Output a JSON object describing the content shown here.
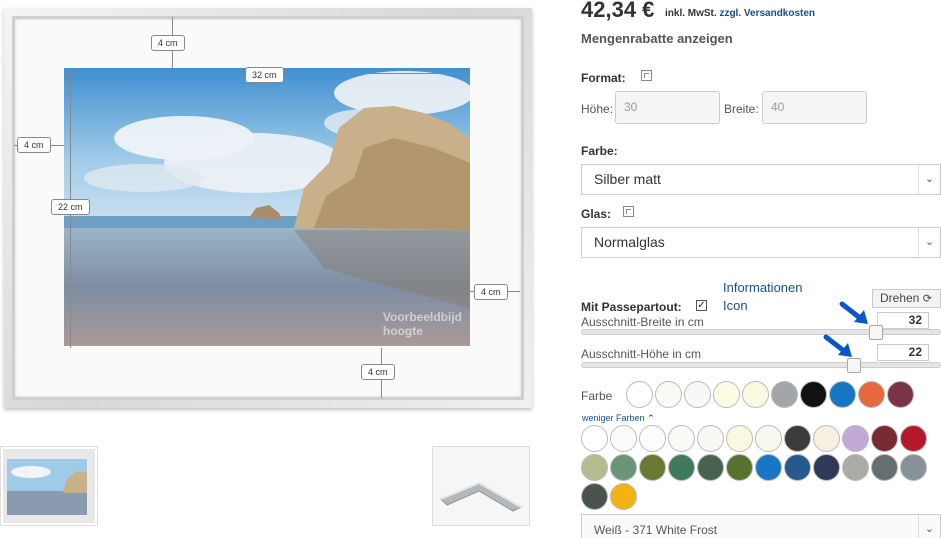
{
  "price": {
    "amount": "42,34 €",
    "tax_note": "inkl. MwSt.",
    "shipping_link": "zzgl. Versandkosten"
  },
  "mengenrabatte_label": "Mengenrabatte anzeigen",
  "format": {
    "label": "Format:",
    "height_label": "Höhe:",
    "height_value": "30",
    "width_label": "Breite:",
    "width_value": "40"
  },
  "farbe": {
    "label": "Farbe:",
    "selected": "Silber matt"
  },
  "glas": {
    "label": "Glas:",
    "selected": "Normalglas"
  },
  "passepartout": {
    "label": "Mit Passepartout:",
    "checked": true,
    "info_text_line1": "Informationen",
    "info_text_line2": "Icon",
    "rotate_label": "Drehen",
    "width_label": "Ausschnitt-Breite in cm",
    "width_value": "32",
    "height_label": "Ausschnitt-Höhe in cm",
    "height_value": "22",
    "color_label": "Farbe",
    "fewer_colors": "weniger Farben",
    "selected_color": "Weiß - 371 White Frost"
  },
  "preview": {
    "dim_top": "4 cm",
    "dim_width": "32 cm",
    "dim_left": "4 cm",
    "dim_height": "22 cm",
    "dim_right": "4 cm",
    "dim_bottom": "4 cm",
    "watermark_line1": "Voorbeeldbijd",
    "watermark_line2": "hoogte"
  },
  "colors": {
    "link": "#1a4f8a",
    "arrow": "#0a55c8"
  },
  "quick_swatches": [
    "#ffffff",
    "#fbfbf5",
    "#f8f8f8",
    "#fdfbe6",
    "#fbf9e2",
    "#a2a5aa",
    "#111111",
    "#1577c4",
    "#e6693e",
    "#7b3346"
  ],
  "all_swatches": [
    "#ffffff",
    "#fbfbfb",
    "#fdfdfd",
    "#fbfbf6",
    "#f8f8f4",
    "#fbf8e0",
    "#f8f8ef",
    "#3b3b3b",
    "#f7efdf",
    "#c2a9d6",
    "#7a2a33",
    "#b5182a",
    "#b4bd8e",
    "#6b9577",
    "#6b7a33",
    "#3f7a5a",
    "#48624d",
    "#56742f",
    "#1877c4",
    "#265a8c",
    "#2e3a5a",
    "#aaaba6",
    "#666f70",
    "#879298",
    "#4b534e",
    "#f5b213"
  ]
}
